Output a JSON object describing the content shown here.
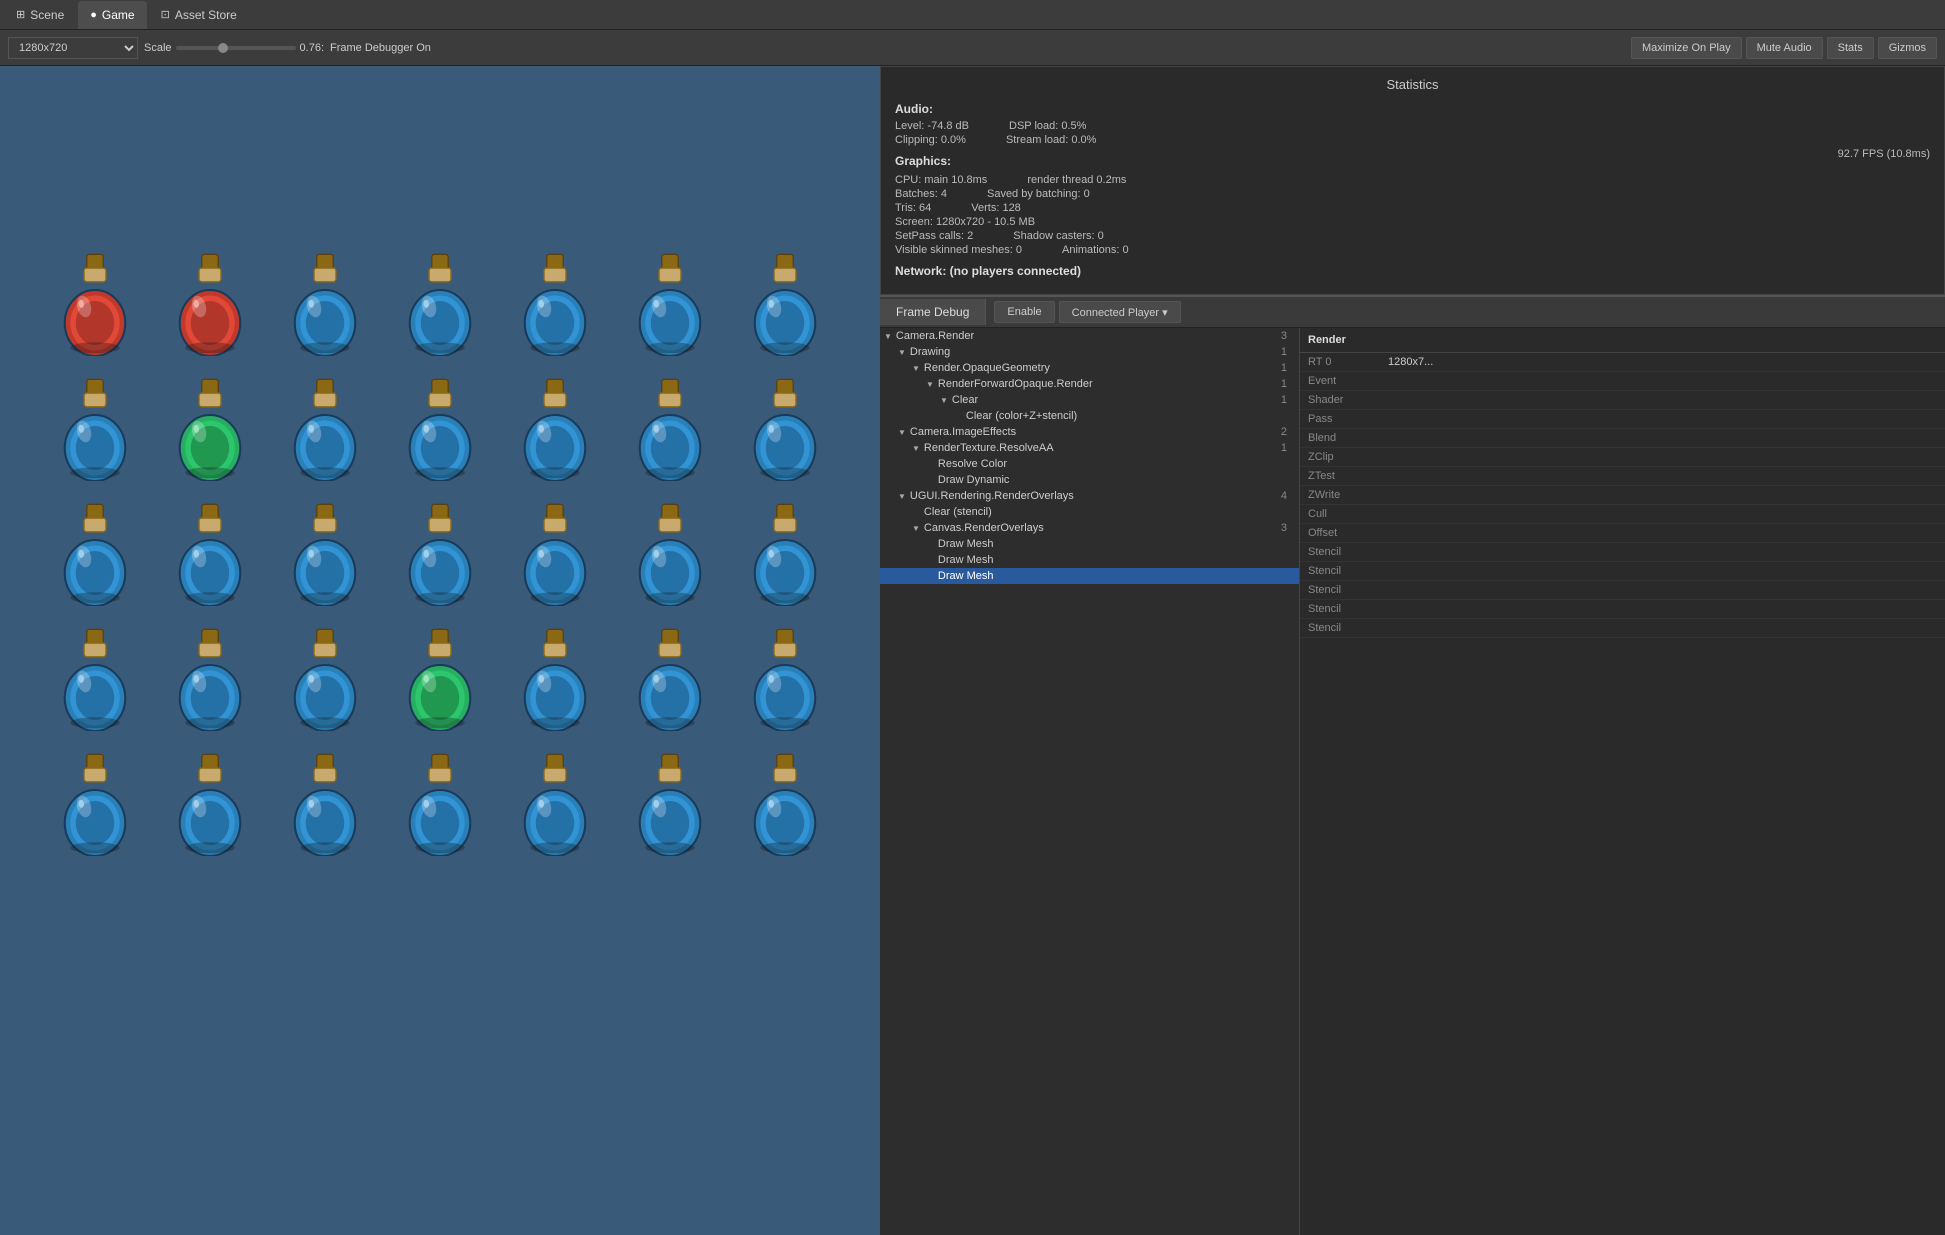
{
  "tabs": [
    {
      "id": "scene",
      "label": "Scene",
      "icon": "⊞",
      "active": false
    },
    {
      "id": "game",
      "label": "Game",
      "icon": "●",
      "active": true
    },
    {
      "id": "asset-store",
      "label": "Asset Store",
      "icon": "⊡",
      "active": false
    }
  ],
  "toolbar": {
    "resolution": "1280x720",
    "scale_label": "Scale",
    "scale_value": "0.76:",
    "frame_debugger": "Frame Debugger On",
    "maximize_on_play": "Maximize On Play",
    "mute_audio": "Mute Audio",
    "stats": "Stats",
    "gizmos": "Gizmos"
  },
  "statistics": {
    "title": "Statistics",
    "audio_label": "Audio:",
    "level": "Level: -74.8 dB",
    "dsp_load": "DSP load: 0.5%",
    "clipping": "Clipping: 0.0%",
    "stream_load": "Stream load: 0.0%",
    "graphics_label": "Graphics:",
    "fps": "92.7 FPS (10.8ms)",
    "cpu_main": "CPU: main 10.8ms",
    "render_thread": "render thread 0.2ms",
    "batches": "Batches: 4",
    "saved_by_batching": "Saved by batching: 0",
    "tris": "Tris: 64",
    "verts": "Verts: 128",
    "screen": "Screen: 1280x720 - 10.5 MB",
    "setpass": "SetPass calls: 2",
    "shadow_casters": "Shadow casters: 0",
    "visible_skinned": "Visible skinned meshes: 0",
    "animations": "Animations: 0",
    "network_label": "Network: (no players connected)"
  },
  "frame_debug": {
    "tab_label": "Frame Debug",
    "enable_btn": "Enable",
    "connected_player_btn": "Connected Player ▾",
    "tree_items": [
      {
        "id": "camera-render",
        "label": "Camera.Render",
        "indent": 0,
        "triangle": "down",
        "count": "3",
        "selected": false
      },
      {
        "id": "drawing",
        "label": "Drawing",
        "indent": 1,
        "triangle": "down",
        "count": "1",
        "selected": false
      },
      {
        "id": "render-opaque-geometry",
        "label": "Render.OpaqueGeometry",
        "indent": 2,
        "triangle": "down",
        "count": "1",
        "selected": false
      },
      {
        "id": "render-forward-opaque",
        "label": "RenderForwardOpaque.Render",
        "indent": 3,
        "triangle": "down",
        "count": "1",
        "selected": false
      },
      {
        "id": "clear",
        "label": "Clear",
        "indent": 4,
        "triangle": "down",
        "count": "1",
        "selected": false
      },
      {
        "id": "clear-color-z-stencil",
        "label": "Clear (color+Z+stencil)",
        "indent": 5,
        "triangle": "none",
        "count": "",
        "selected": false
      },
      {
        "id": "camera-image-effects",
        "label": "Camera.ImageEffects",
        "indent": 1,
        "triangle": "down",
        "count": "2",
        "selected": false
      },
      {
        "id": "render-texture-resolve-aa",
        "label": "RenderTexture.ResolveAA",
        "indent": 2,
        "triangle": "down",
        "count": "1",
        "selected": false
      },
      {
        "id": "resolve-color",
        "label": "Resolve Color",
        "indent": 3,
        "triangle": "none",
        "count": "",
        "selected": false
      },
      {
        "id": "draw-dynamic",
        "label": "Draw Dynamic",
        "indent": 3,
        "triangle": "none",
        "count": "",
        "selected": false
      },
      {
        "id": "ugui-rendering-render-overlays",
        "label": "UGUI.Rendering.RenderOverlays",
        "indent": 1,
        "triangle": "down",
        "count": "4",
        "selected": false
      },
      {
        "id": "clear-stencil",
        "label": "Clear (stencil)",
        "indent": 2,
        "triangle": "none",
        "count": "",
        "selected": false
      },
      {
        "id": "canvas-render-overlays",
        "label": "Canvas.RenderOverlays",
        "indent": 2,
        "triangle": "down",
        "count": "3",
        "selected": false
      },
      {
        "id": "draw-mesh-1",
        "label": "Draw Mesh",
        "indent": 3,
        "triangle": "none",
        "count": "",
        "selected": false
      },
      {
        "id": "draw-mesh-2",
        "label": "Draw Mesh",
        "indent": 3,
        "triangle": "none",
        "count": "",
        "selected": false
      },
      {
        "id": "draw-mesh-3",
        "label": "Draw Mesh",
        "indent": 3,
        "triangle": "none",
        "count": "",
        "selected": true
      }
    ],
    "details_header": "Render",
    "details": {
      "rt": "RT 0",
      "resolution": "1280x7...",
      "event_label": "Event",
      "shader_label": "Shader",
      "pass_label": "Pass",
      "blend_label": "Blend",
      "zclip_label": "ZClip",
      "ztest_label": "ZTest",
      "zwrite_label": "ZWrite",
      "cull_label": "Cull",
      "offset_label": "Offset",
      "stencil_rows": [
        "Stencil",
        "Stencil",
        "Stencil",
        "Stencil",
        "Stencil"
      ]
    }
  },
  "bottles": {
    "layout": [
      [
        "red",
        "red",
        "blue",
        "blue",
        "blue",
        "blue",
        "blue"
      ],
      [
        "blue",
        "green",
        "blue",
        "blue",
        "blue",
        "blue",
        "blue"
      ],
      [
        "blue",
        "blue",
        "blue",
        "blue",
        "blue",
        "blue",
        "blue"
      ],
      [
        "blue",
        "blue",
        "blue",
        "green",
        "blue",
        "blue",
        "blue"
      ],
      [
        "blue",
        "blue",
        "blue",
        "blue",
        "blue",
        "blue",
        "blue"
      ]
    ]
  }
}
